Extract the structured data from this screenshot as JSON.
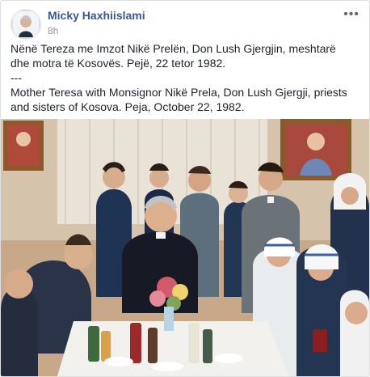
{
  "post": {
    "author": "Micky Haxhiislami",
    "time": "8h",
    "more_icon": "•••",
    "text_sq": "Nënë Tereza me Imzot Nikë Prelën, Don Lush Gjergjin, meshtarë dhe motra të Kosovës. Pejë, 22 tetor 1982.",
    "separator": "---",
    "text_en": "Mother Teresa with Monsignor Nikë Prela, Don Lush Gjergji, priests and sisters of Kosova. Peja, October 22, 1982."
  },
  "icons": {
    "avatar": "profile-photo",
    "more": "more-options-icon"
  }
}
